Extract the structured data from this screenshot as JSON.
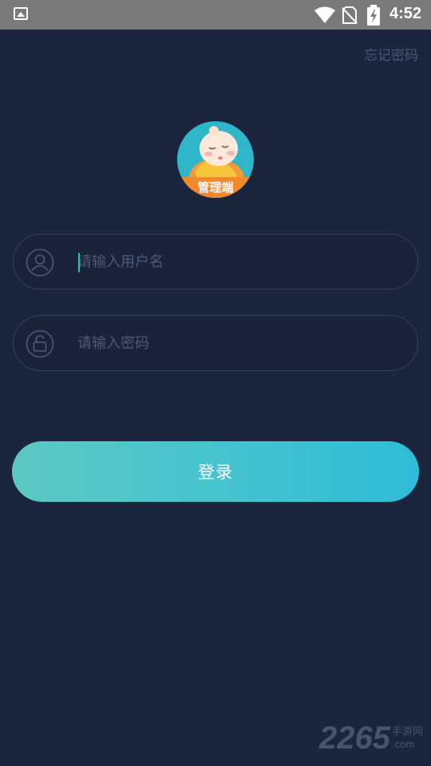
{
  "status_bar": {
    "time": "4:52",
    "icons": [
      "image-icon",
      "wifi-icon",
      "no-sim-icon",
      "battery-charging-icon"
    ]
  },
  "header": {
    "forgot_password": "忘记密码"
  },
  "logo": {
    "label": "管理端"
  },
  "form": {
    "username_placeholder": "请输入用户名",
    "username_value": "",
    "password_placeholder": "请输入密码",
    "password_value": ""
  },
  "login_button": "登录",
  "watermark": {
    "number": "2265",
    "top": "手游网",
    "bottom": ".com"
  },
  "colors": {
    "background": "#1b253d",
    "accent_start": "#5dc8c2",
    "accent_end": "#2fbcd8",
    "caret": "#2cc3b8"
  }
}
